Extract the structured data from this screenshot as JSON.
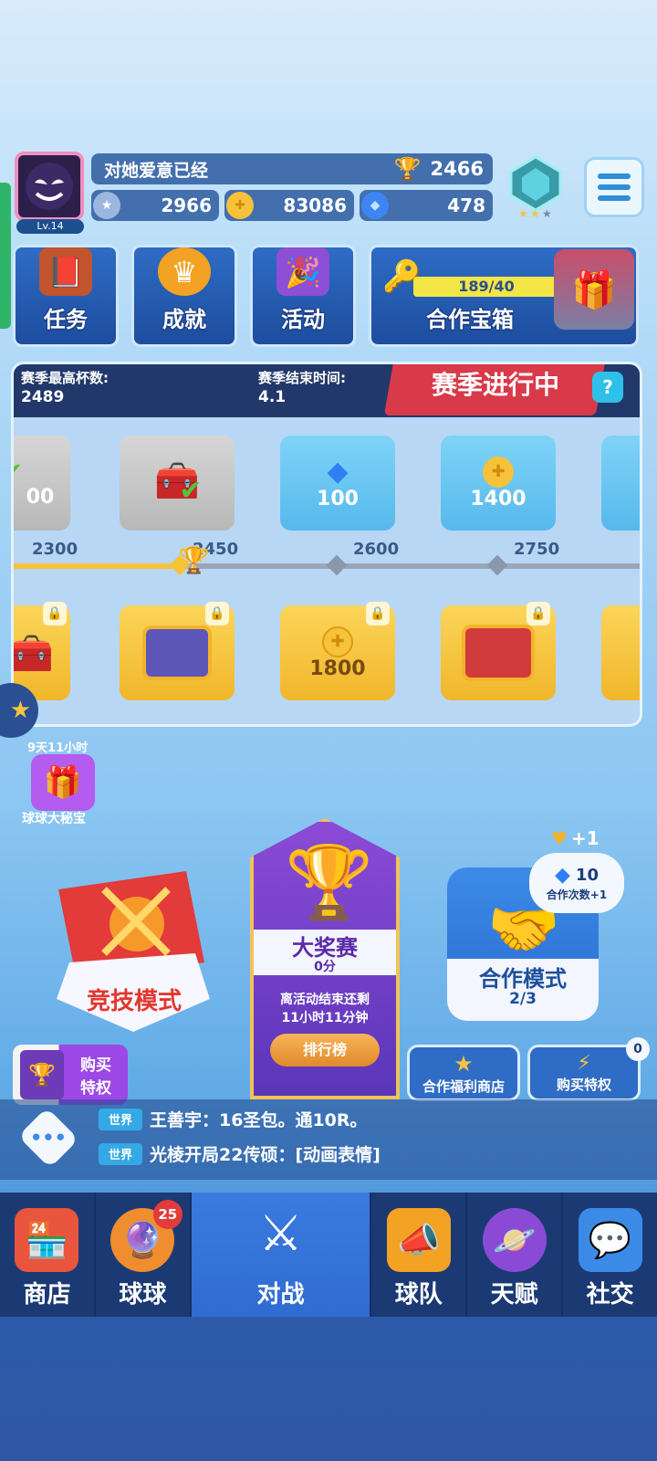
{
  "player": {
    "level": "Lv.14",
    "name": "对她爱意已经",
    "trophies": "2466"
  },
  "resources": {
    "stars": "2966",
    "coins": "83086",
    "gems": "478"
  },
  "tiles": [
    {
      "label": "任务"
    },
    {
      "label": "成就"
    },
    {
      "label": "活动"
    },
    {
      "label": "合作宝箱",
      "progress_text": "189/40"
    }
  ],
  "season": {
    "best_label": "赛季最高杯数:",
    "best_value": "2489",
    "end_label": "赛季结束时间:",
    "end_value": "4.1",
    "status": "赛季进行中",
    "help": "?",
    "top_rewards": [
      "00",
      "",
      "100",
      "1400"
    ],
    "milestones": [
      "2300",
      "2450",
      "2600",
      "2750"
    ],
    "bottom_rewards": [
      "",
      "",
      "1800",
      ""
    ]
  },
  "event": {
    "timer": "9天11小时",
    "name": "球球大秘宝"
  },
  "modes": {
    "competitive": "竞技模式",
    "tournament": {
      "title": "大奖赛",
      "score": "0分",
      "desc1": "离活动结束还剩",
      "desc2": "11小时11分钟",
      "rank_button": "排行榜"
    },
    "coop": {
      "title": "合作模式",
      "count": "2/3",
      "plus": "+1",
      "bubble_value": "10",
      "bubble_text": "合作次数+1"
    }
  },
  "buttons": {
    "buy_left_1": "购买",
    "buy_left_2": "特权",
    "coop_shop": "合作福利商店",
    "buy_privilege": "购买特权",
    "buy_privilege_badge": "0"
  },
  "chat": {
    "lines": [
      {
        "channel": "世界",
        "text": "王善宇：16圣包。通10R。"
      },
      {
        "channel": "世界",
        "text": "光棱开局22传硕：[动画表情]"
      }
    ]
  },
  "nav": [
    {
      "label": "商店"
    },
    {
      "label": "球球",
      "badge": "25"
    },
    {
      "label": "对战"
    },
    {
      "label": "球队"
    },
    {
      "label": "天赋"
    },
    {
      "label": "社交"
    }
  ],
  "colors": {
    "accent": "#2f6cd2",
    "gold": "#f1b62a",
    "panel": "#22386a"
  }
}
